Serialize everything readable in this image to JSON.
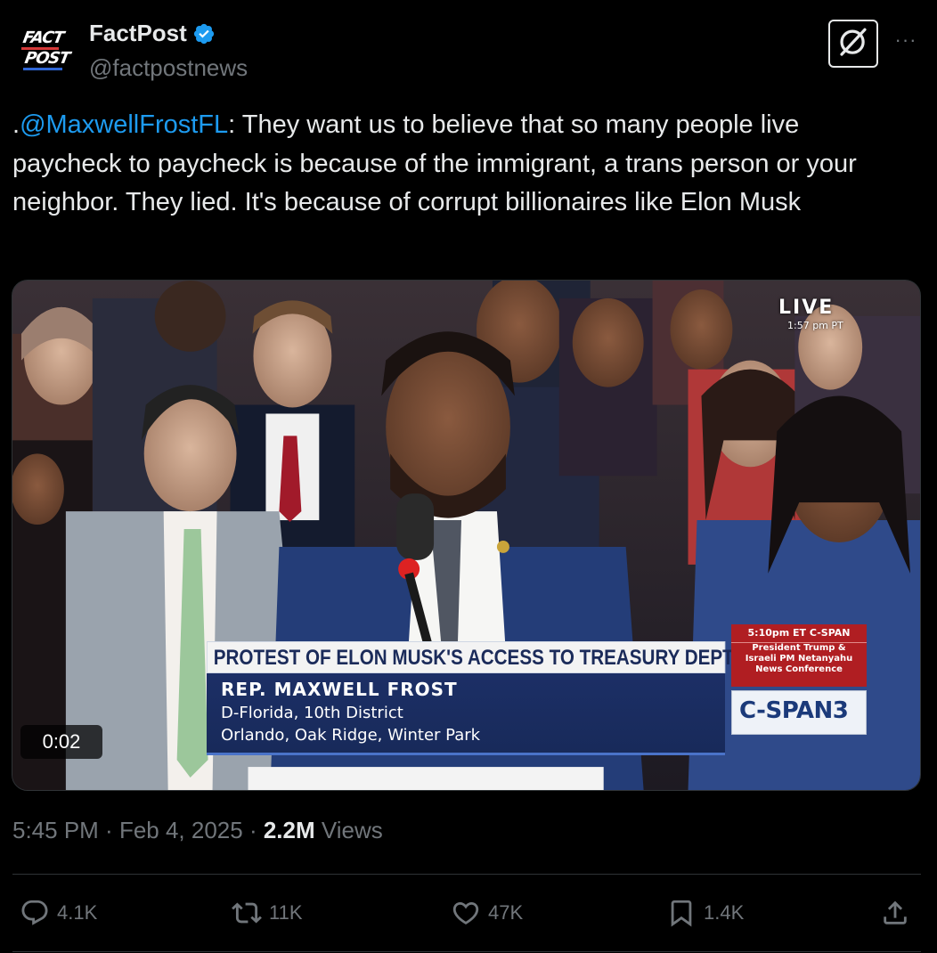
{
  "author": {
    "logo_text_top": "FACT",
    "logo_text_bottom": "POST",
    "display_name": "FactPost",
    "handle": "@factpostnews",
    "verified_icon": "verified-badge-icon",
    "verified_color": "#1d9bf0"
  },
  "header_actions": {
    "grok_icon": "grok-icon",
    "more_icon": "more-options-icon",
    "more_label": "···"
  },
  "tweet": {
    "prefix": ".",
    "mention": "@MaxwellFrostFL",
    "body": ": They want us to believe that so many people live paycheck to paycheck is because of the immigrant, a trans person or your neighbor. They lied. It's because of corrupt billionaires like Elon Musk",
    "mention_color": "#1d9bf0"
  },
  "video": {
    "live_label": "LIVE",
    "live_time": "1:57 pm PT",
    "chyron_title": "PROTEST OF ELON MUSK'S ACCESS TO TREASURY DEPT.",
    "chyron_name": "REP. MAXWELL FROST",
    "chyron_line1": "D-Florida, 10th District",
    "chyron_line2": "Orlando, Oak Ridge, Winter Park",
    "promo_head": "5:10pm ET C-SPAN",
    "promo_line1": "President Trump &",
    "promo_line2": "Israeli PM Netanyahu",
    "promo_line3": "News Conference",
    "network_logo": "C-SPAN3",
    "elapsed": "0:02"
  },
  "meta": {
    "time": "5:45 PM",
    "separator": " · ",
    "date": "Feb 4, 2025",
    "views_count": "2.2M",
    "views_label": " Views"
  },
  "actions": {
    "reply": {
      "icon": "reply-icon",
      "count": "4.1K"
    },
    "repost": {
      "icon": "repost-icon",
      "count": "11K"
    },
    "like": {
      "icon": "like-icon",
      "count": "47K"
    },
    "bookmark": {
      "icon": "bookmark-icon",
      "count": "1.4K"
    },
    "share": {
      "icon": "share-icon"
    }
  },
  "colors": {
    "background": "#000000",
    "text_primary": "#e7e9ea",
    "text_secondary": "#71767b",
    "link": "#1d9bf0",
    "divider": "#2f3336"
  }
}
